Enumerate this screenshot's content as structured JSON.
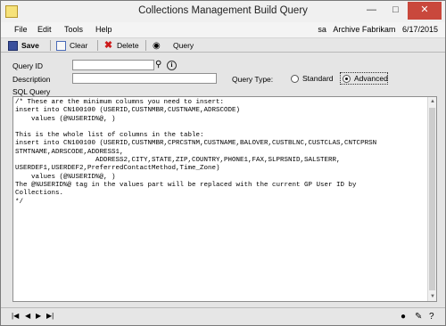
{
  "window": {
    "title": "Collections Management Build Query"
  },
  "menu": [
    "File",
    "Edit",
    "Tools",
    "Help"
  ],
  "user_info": {
    "user": "sa",
    "company": "Archive Fabrikam",
    "date": "6/17/2015"
  },
  "toolbar": {
    "save": "Save",
    "clear": "Clear",
    "delete": "Delete",
    "query": "Query"
  },
  "form": {
    "query_id_label": "Query ID",
    "query_id_value": "",
    "description_label": "Description",
    "description_value": "",
    "query_type_label": "Query Type:",
    "standard_label": "Standard",
    "advanced_label": "Advanced",
    "selected_query_type": "Advanced",
    "sql_label": "SQL Query"
  },
  "sql_text": "/* These are the minimum columns you need to insert:\ninsert into CN100100 (USERID,CUSTNMBR,CUSTNAME,ADRSCODE)\n    values (@%USERID%@, )\n\nThis is the whole list of columns in the table:\ninsert into CN100100 (USERID,CUSTNMBR,CPRCSTNM,CUSTNAME,BALOVER,CUSTBLNC,CUSTCLAS,CNTCPRSN\nSTMTNAME,ADRSCODE,ADDRESS1,\n                    ADDRESS2,CITY,STATE,ZIP,COUNTRY,PHONE1,FAX,SLPRSNID,SALSTERR,\nUSERDEF1,USERDEF2,PreferredContactMethod,Time_Zone)\n    values (@%USERID%@, )\nThe @%USERID%@ tag in the values part will be replaced with the current GP User ID by\nCollections.\n*/",
  "bottombar": {
    "nav_first": "|◀",
    "nav_prev": "◀",
    "nav_next": "▶",
    "nav_last": "▶|"
  }
}
